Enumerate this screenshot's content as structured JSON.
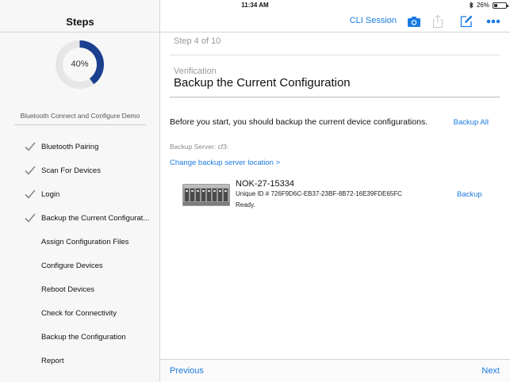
{
  "status_bar": {
    "device": "iPad",
    "time": "11:34 AM",
    "battery": "26%"
  },
  "sidebar": {
    "title": "Steps",
    "progress_percent": 40,
    "progress_label": "40%",
    "demo_label": "Bluetooth Connect and Configure Demo",
    "steps": [
      {
        "label": "Bluetooth Pairing",
        "done": true
      },
      {
        "label": "Scan For Devices",
        "done": true
      },
      {
        "label": "Login",
        "done": true
      },
      {
        "label": "Backup the Current Configurat...",
        "done": true
      },
      {
        "label": "Assign Configuration Files",
        "done": false
      },
      {
        "label": "Configure Devices",
        "done": false
      },
      {
        "label": "Reboot Devices",
        "done": false
      },
      {
        "label": "Check for Connectivity",
        "done": false
      },
      {
        "label": "Backup the Configuration",
        "done": false
      },
      {
        "label": "Report",
        "done": false
      }
    ]
  },
  "toolbar": {
    "cli_session": "CLI Session",
    "icons": [
      "camera-icon",
      "share-icon",
      "edit-icon",
      "more-icon"
    ]
  },
  "main": {
    "step_counter": "Step 4 of 10",
    "section": "Verification",
    "title": "Backup the Current Configuration",
    "intro": "Before you start, you should backup the current device configurations.",
    "backup_all": "Backup All",
    "server_label": "Backup Server: cf3:",
    "change_server": "Change backup server location >",
    "device": {
      "name": "NOK-27-15334",
      "uid": "Unique ID # 726F9D6C-EB37-23BF-8B72-16E39FDE65FC",
      "status": "Ready.",
      "backup_label": "Backup"
    }
  },
  "bottom_bar": {
    "previous": "Previous",
    "next": "Next"
  },
  "colors": {
    "accent": "#1a7ae0",
    "progress": "#1b3f8f",
    "progress_track": "#e6e6e6"
  }
}
